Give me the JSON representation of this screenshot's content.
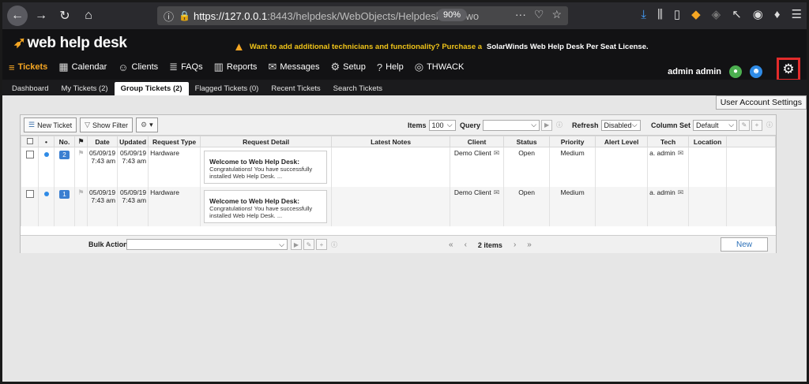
{
  "browser": {
    "url_host": "https://127.0.0.1",
    "url_rest": ":8443/helpdesk/WebObjects/Helpdesk.woa/wo",
    "zoom": "90%",
    "dots": "···"
  },
  "header": {
    "logo": "web help desk",
    "banner_text": "Want to add additional technicians and functionality? Purchase a ",
    "banner_bold": "SolarWinds Web Help Desk Per Seat License.",
    "user_name": "admin admin"
  },
  "mainnav": [
    {
      "label": "Tickets",
      "icon": "≡"
    },
    {
      "label": "Calendar",
      "icon": "▦"
    },
    {
      "label": "Clients",
      "icon": "☺"
    },
    {
      "label": "FAQs",
      "icon": "≣"
    },
    {
      "label": "Reports",
      "icon": "▥"
    },
    {
      "label": "Messages",
      "icon": "✉"
    },
    {
      "label": "Setup",
      "icon": "⚙"
    },
    {
      "label": "Help",
      "icon": "?"
    },
    {
      "label": "THWACK",
      "icon": "◎"
    }
  ],
  "subtabs": [
    "Dashboard",
    "My Tickets (2)",
    "Group Tickets (2)",
    "Flagged Tickets (0)",
    "Recent Tickets",
    "Search Tickets"
  ],
  "tooltip": "User Account Settings",
  "toolbar": {
    "new_ticket": "New Ticket",
    "show_filter": "Show Filter",
    "items_label": "Items",
    "items_value": "100",
    "query_label": "Query",
    "refresh_label": "Refresh",
    "refresh_value": "Disabled",
    "colset_label": "Column Set",
    "colset_value": "Default"
  },
  "columns": [
    "",
    "•",
    "No.",
    "⚑",
    "Date",
    "Updated",
    "Request Type",
    "Request Detail",
    "Latest Notes",
    "Client",
    "Status",
    "Priority",
    "Alert Level",
    "Tech",
    "Location"
  ],
  "rows": [
    {
      "no": "2",
      "date": "05/09/19",
      "date_time": "7:43 am",
      "updated": "05/09/19",
      "updated_time": "7:43 am",
      "type": "Hardware",
      "detail_title": "Welcome to Web Help Desk:",
      "detail_body": "Congratulations! You have successfully installed Web Help Desk. ...",
      "client": "Demo Client",
      "status": "Open",
      "priority": "Medium",
      "tech": "a. admin"
    },
    {
      "no": "1",
      "date": "05/09/19",
      "date_time": "7:43 am",
      "updated": "05/09/19",
      "updated_time": "7:43 am",
      "type": "Hardware",
      "detail_title": "Welcome to Web Help Desk:",
      "detail_body": "Congratulations! You have successfully installed Web Help Desk. ...",
      "client": "Demo Client",
      "status": "Open",
      "priority": "Medium",
      "tech": "a. admin"
    }
  ],
  "bulk": {
    "label": "Bulk Action",
    "pager_text": "2 items",
    "new_label": "New"
  }
}
